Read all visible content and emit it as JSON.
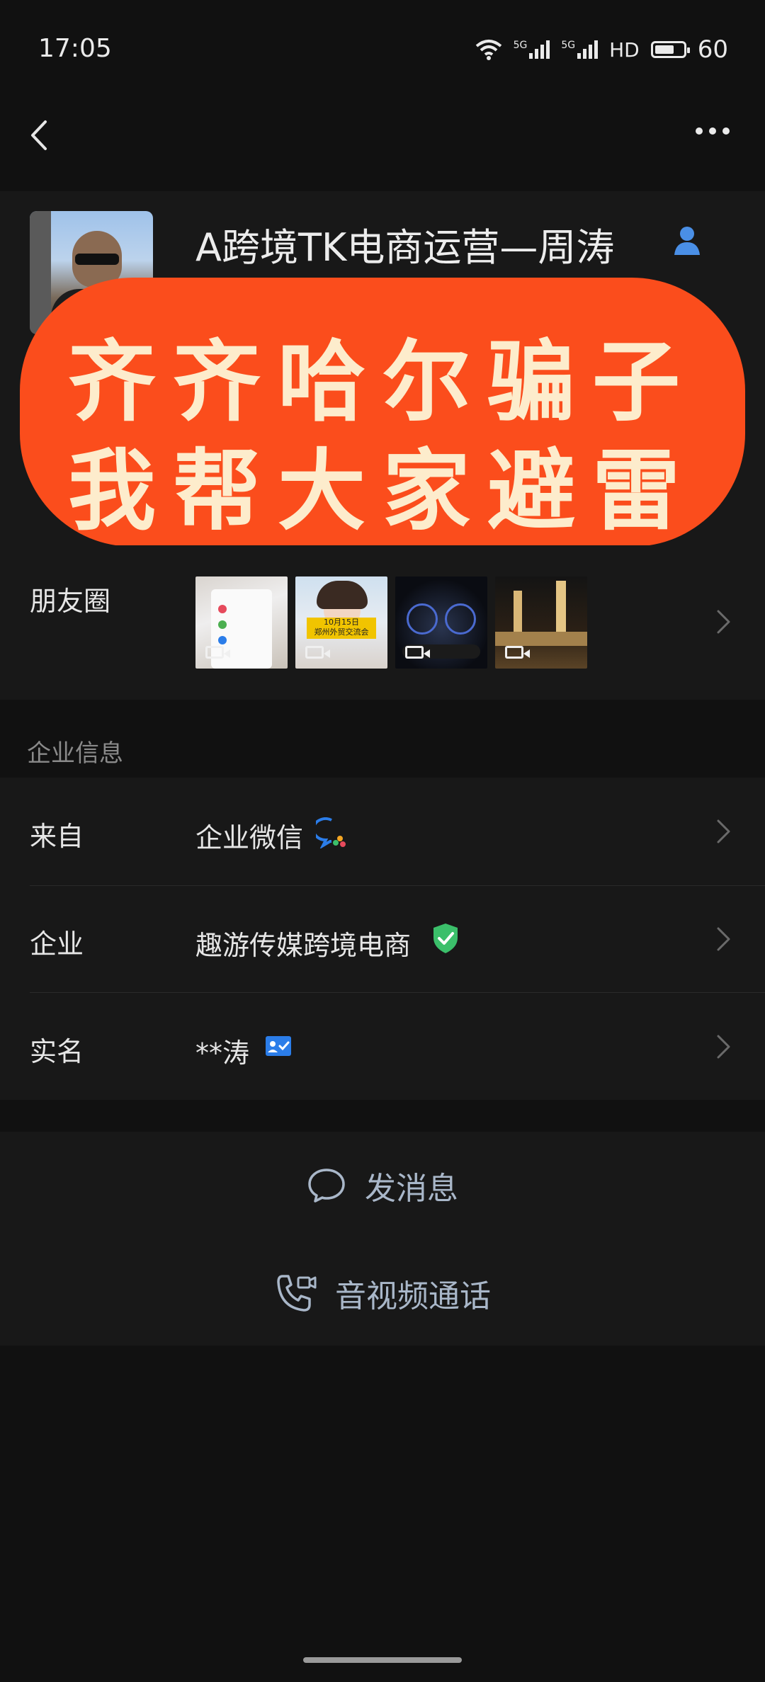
{
  "status_bar": {
    "time": "17:05",
    "network1": "5G",
    "network2": "5G",
    "hd": "HD",
    "battery": "60"
  },
  "profile": {
    "name": "A跨境TK电商运营—周涛"
  },
  "overlay_banner": {
    "line1": "齐齐哈尔骗子",
    "line2": "我帮大家避雷"
  },
  "moments": {
    "label": "朋友圈",
    "thumb_overlay_text": "10月15日\n郑州外贸交流会"
  },
  "enterprise_info": {
    "section_title": "企业信息",
    "rows": [
      {
        "label": "来自",
        "value": "企业微信"
      },
      {
        "label": "企业",
        "value": "趣游传媒跨境电商"
      },
      {
        "label": "实名",
        "value": "**涛"
      }
    ]
  },
  "actions": {
    "message": "发消息",
    "call": "音视频通话"
  },
  "colors": {
    "banner_bg": "#fb4d1c",
    "banner_text": "#fdeccc",
    "action_text": "#a9b7c9",
    "verified_green": "#3bbf6a",
    "id_blue": "#2b7de9"
  }
}
